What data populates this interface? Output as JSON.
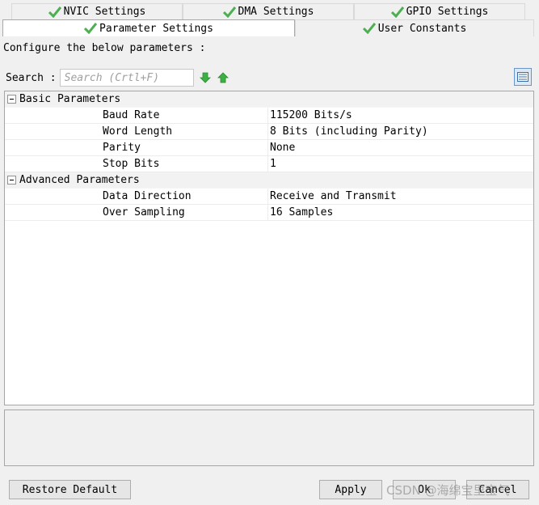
{
  "tabs_row1": [
    {
      "label": "NVIC Settings"
    },
    {
      "label": "DMA Settings"
    },
    {
      "label": "GPIO Settings"
    }
  ],
  "tabs_row2": [
    {
      "label": "Parameter Settings",
      "active": true
    },
    {
      "label": "User Constants"
    }
  ],
  "describe_text": "Configure the below parameters :",
  "search": {
    "label": "Search :",
    "placeholder": "Search (Crtl+F)",
    "value": ""
  },
  "groups": [
    {
      "name": "Basic Parameters",
      "rows": [
        {
          "key": "Baud Rate",
          "value": "115200 Bits/s"
        },
        {
          "key": "Word Length",
          "value": "8 Bits (including Parity)"
        },
        {
          "key": "Parity",
          "value": "None"
        },
        {
          "key": "Stop Bits",
          "value": "1"
        }
      ]
    },
    {
      "name": "Advanced Parameters",
      "rows": [
        {
          "key": "Data Direction",
          "value": "Receive and Transmit"
        },
        {
          "key": "Over Sampling",
          "value": "16 Samples"
        }
      ]
    }
  ],
  "buttons": {
    "restore": "Restore Default",
    "apply": "Apply",
    "ok": "Ok",
    "cancel": "Cancel"
  },
  "watermark": "CSDN @海绵宝里宝气",
  "colors": {
    "check": "#4caf50",
    "arrow": "#3cb043",
    "view_btn": "#3a6ea5"
  }
}
